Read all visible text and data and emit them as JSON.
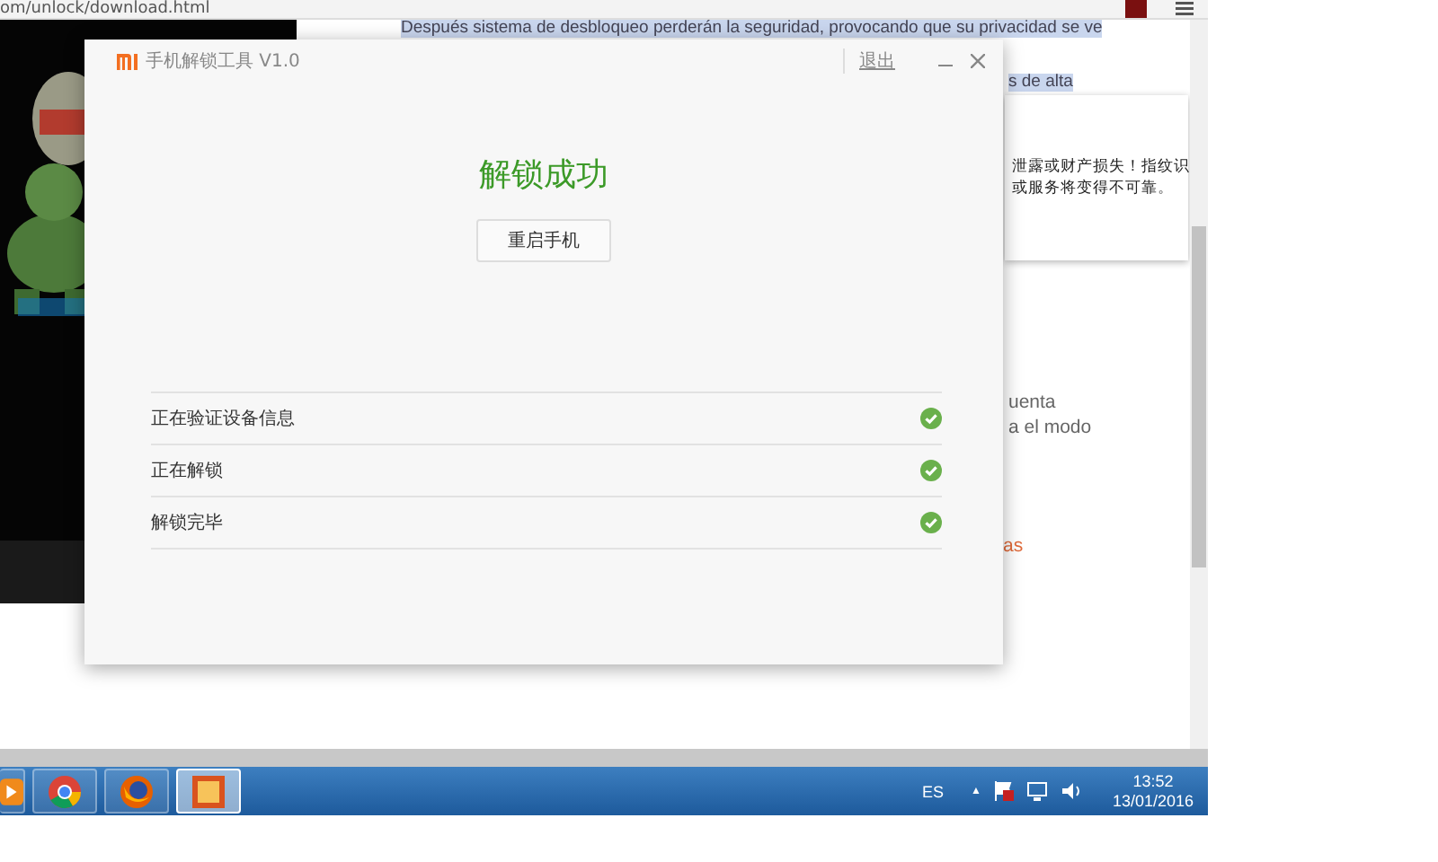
{
  "browser": {
    "address": "om/unlock/download.html",
    "page": {
      "highlight_lines": [
        "Después sistema de desbloqueo perderán la seguridad, provocando que su privacidad se ve",
        "s de alta"
      ],
      "card_lines": [
        "泄露或财产损失！指纹识",
        "或服务将变得不可靠。"
      ],
      "text_lines": [
        "uenta",
        "a el modo"
      ],
      "link": "as"
    }
  },
  "dialog": {
    "title": "手机解锁工具 V1.0",
    "logout": "退出",
    "heading": "解锁成功",
    "button": "重启手机",
    "steps": [
      {
        "label": "正在验证设备信息",
        "done": true
      },
      {
        "label": "正在解锁",
        "done": true
      },
      {
        "label": "解锁完毕",
        "done": true
      }
    ]
  },
  "taskbar": {
    "apps": [
      {
        "kind": "media",
        "selected": false
      },
      {
        "kind": "chrome",
        "selected": false
      },
      {
        "kind": "firefox",
        "selected": false
      },
      {
        "kind": "app",
        "selected": true
      }
    ],
    "language": "ES",
    "tray_arrow": "▲",
    "time": "13:52",
    "date": "13/01/2016"
  }
}
